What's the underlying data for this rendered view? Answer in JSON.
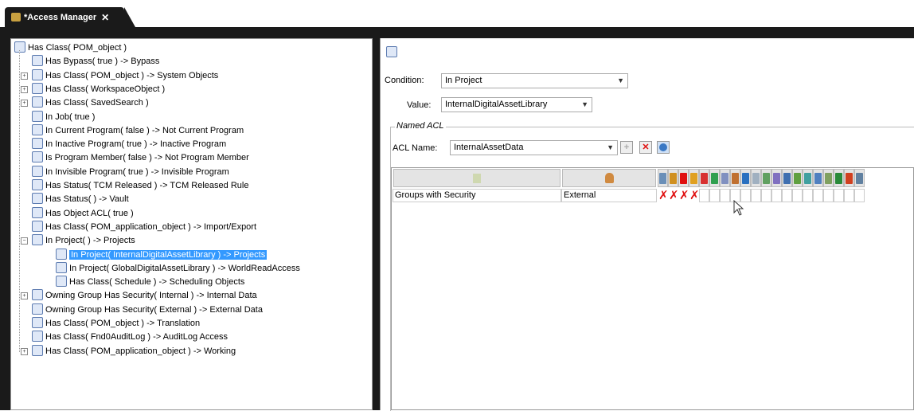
{
  "tab": {
    "title": "*Access Manager",
    "close_glyph": "✕"
  },
  "tree": {
    "root": "Has Class( POM_object )",
    "items": [
      {
        "label": "Has Bypass( true ) -> Bypass",
        "expandable": false
      },
      {
        "label": "Has Class( POM_object ) -> System Objects",
        "expandable": true
      },
      {
        "label": "Has Class( WorkspaceObject )",
        "expandable": true
      },
      {
        "label": "Has Class( SavedSearch )",
        "expandable": true
      },
      {
        "label": "In Job( true )",
        "expandable": false
      },
      {
        "label": "In Current Program( false ) -> Not Current Program",
        "expandable": false
      },
      {
        "label": "In Inactive Program( true ) -> Inactive Program",
        "expandable": false
      },
      {
        "label": "Is Program Member( false ) -> Not Program Member",
        "expandable": false
      },
      {
        "label": "In Invisible Program( true ) -> Invisible Program",
        "expandable": false
      },
      {
        "label": "Has Status( TCM Released ) -> TCM Released Rule",
        "expandable": false
      },
      {
        "label": "Has Status( ) -> Vault",
        "expandable": false
      },
      {
        "label": "Has Object ACL( true )",
        "expandable": false
      },
      {
        "label": "Has Class( POM_application_object ) -> Import/Export",
        "expandable": false
      },
      {
        "label": "In Project( ) -> Projects",
        "expandable": true,
        "expanded": true
      },
      {
        "label": "Owning Group Has Security( Internal ) -> Internal Data",
        "expandable": true
      },
      {
        "label": "Owning Group Has Security( External ) -> External Data",
        "expandable": false
      },
      {
        "label": "Has Class( POM_object ) -> Translation",
        "expandable": false
      },
      {
        "label": "Has Class( Fnd0AuditLog ) -> AuditLog Access",
        "expandable": false
      },
      {
        "label": "Has Class( POM_application_object ) -> Working",
        "expandable": true
      }
    ],
    "children": [
      {
        "label": "In Project( InternalDigitalAssetLibrary ) -> Projects",
        "selected": true
      },
      {
        "label": "In Project( GlobalDigitalAssetLibrary ) -> WorldReadAccess",
        "selected": false
      },
      {
        "label": "Has Class( Schedule ) -> Scheduling Objects",
        "selected": false
      }
    ]
  },
  "detail": {
    "condition_label": "Condition:",
    "condition_value": "In Project",
    "value_label": "Value:",
    "value_value": "InternalDigitalAssetLibrary",
    "named_acl_title": "Named ACL",
    "acl_name_label": "ACL Name:",
    "acl_name_value": "InternalAssetData",
    "remove_glyph": "✕",
    "add_glyph": "+"
  },
  "grid": {
    "row": {
      "accessor": "Groups with Security",
      "value": "External"
    },
    "denied_glyph": "✗",
    "denied_count": 4,
    "privilege_columns": 20
  },
  "colors": {
    "selection": "#3399ff",
    "deny": "#e01010",
    "tab_bg": "#1a1a1a"
  }
}
